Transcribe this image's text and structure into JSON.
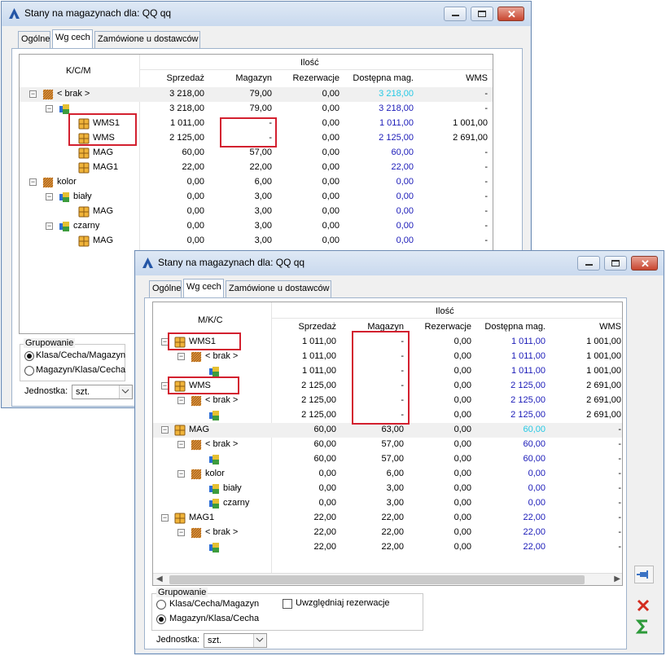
{
  "back": {
    "title": "Stany na magazynach dla: QQ qq",
    "tabs": [
      "Ogólne",
      "Wg cech",
      "Zamówione u dostawców"
    ],
    "tree_header": "K/C/M",
    "group_header": "Ilość",
    "columns": [
      "Sprzedaż",
      "Magazyn",
      "Rezerwacje",
      "Dostępna mag.",
      "WMS"
    ],
    "rows": [
      {
        "label": "< brak >",
        "cols": [
          "3 218,00",
          "79,00",
          "0,00",
          "3 218,00",
          "-"
        ]
      },
      {
        "label": "",
        "cols": [
          "3 218,00",
          "79,00",
          "0,00",
          "3 218,00",
          "-"
        ]
      },
      {
        "label": "WMS1",
        "cols": [
          "1 011,00",
          "-",
          "0,00",
          "1 011,00",
          "1 001,00"
        ]
      },
      {
        "label": "WMS",
        "cols": [
          "2 125,00",
          "-",
          "0,00",
          "2 125,00",
          "2 691,00"
        ]
      },
      {
        "label": "MAG",
        "cols": [
          "60,00",
          "57,00",
          "0,00",
          "60,00",
          "-"
        ]
      },
      {
        "label": "MAG1",
        "cols": [
          "22,00",
          "22,00",
          "0,00",
          "22,00",
          "-"
        ]
      },
      {
        "label": "kolor",
        "cols": [
          "0,00",
          "6,00",
          "0,00",
          "0,00",
          "-"
        ]
      },
      {
        "label": "biały",
        "cols": [
          "0,00",
          "3,00",
          "0,00",
          "0,00",
          "-"
        ]
      },
      {
        "label": "MAG",
        "cols": [
          "0,00",
          "3,00",
          "0,00",
          "0,00",
          "-"
        ]
      },
      {
        "label": "czarny",
        "cols": [
          "0,00",
          "3,00",
          "0,00",
          "0,00",
          "-"
        ]
      },
      {
        "label": "MAG",
        "cols": [
          "0,00",
          "3,00",
          "0,00",
          "0,00",
          "-"
        ]
      }
    ],
    "grouping_label": "Grupowanie",
    "grouping_options": [
      "Klasa/Cecha/Magazyn",
      "Magazyn/Klasa/Cecha"
    ],
    "unit_label": "Jednostka:",
    "unit_value": "szt."
  },
  "front": {
    "title": "Stany na magazynach dla: QQ qq",
    "tabs": [
      "Ogólne",
      "Wg cech",
      "Zamówione u dostawców"
    ],
    "tree_header": "M/K/C",
    "group_header": "Ilość",
    "columns": [
      "Sprzedaż",
      "Magazyn",
      "Rezerwacje",
      "Dostępna mag.",
      "WMS"
    ],
    "rows": [
      {
        "label": "WMS1",
        "cols": [
          "1 011,00",
          "-",
          "0,00",
          "1 011,00",
          "1 001,00"
        ]
      },
      {
        "label": "< brak >",
        "cols": [
          "1 011,00",
          "-",
          "0,00",
          "1 011,00",
          "1 001,00"
        ]
      },
      {
        "label": "",
        "cols": [
          "1 011,00",
          "-",
          "0,00",
          "1 011,00",
          "1 001,00"
        ]
      },
      {
        "label": "WMS",
        "cols": [
          "2 125,00",
          "-",
          "0,00",
          "2 125,00",
          "2 691,00"
        ]
      },
      {
        "label": "< brak >",
        "cols": [
          "2 125,00",
          "-",
          "0,00",
          "2 125,00",
          "2 691,00"
        ]
      },
      {
        "label": "",
        "cols": [
          "2 125,00",
          "-",
          "0,00",
          "2 125,00",
          "2 691,00"
        ]
      },
      {
        "label": "MAG",
        "cols": [
          "60,00",
          "63,00",
          "0,00",
          "60,00",
          "-"
        ]
      },
      {
        "label": "< brak >",
        "cols": [
          "60,00",
          "57,00",
          "0,00",
          "60,00",
          "-"
        ]
      },
      {
        "label": "",
        "cols": [
          "60,00",
          "57,00",
          "0,00",
          "60,00",
          "-"
        ]
      },
      {
        "label": "kolor",
        "cols": [
          "0,00",
          "6,00",
          "0,00",
          "0,00",
          "-"
        ]
      },
      {
        "label": "biały",
        "cols": [
          "0,00",
          "3,00",
          "0,00",
          "0,00",
          "-"
        ]
      },
      {
        "label": "czarny",
        "cols": [
          "0,00",
          "3,00",
          "0,00",
          "0,00",
          "-"
        ]
      },
      {
        "label": "MAG1",
        "cols": [
          "22,00",
          "22,00",
          "0,00",
          "22,00",
          "-"
        ]
      },
      {
        "label": "< brak >",
        "cols": [
          "22,00",
          "22,00",
          "0,00",
          "22,00",
          "-"
        ]
      },
      {
        "label": "",
        "cols": [
          "22,00",
          "22,00",
          "0,00",
          "22,00",
          "-"
        ]
      }
    ],
    "grouping_label": "Grupowanie",
    "grouping_options": [
      "Klasa/Cecha/Magazyn",
      "Magazyn/Klasa/Cecha"
    ],
    "checkbox_label": "Uwzględniaj rezerwacje",
    "unit_label": "Jednostka:",
    "unit_value": "szt."
  },
  "colors": {
    "accent_blue": "#1a1ab8",
    "accent_cyan": "#26c9e5",
    "highlight_red": "#d3202f"
  }
}
